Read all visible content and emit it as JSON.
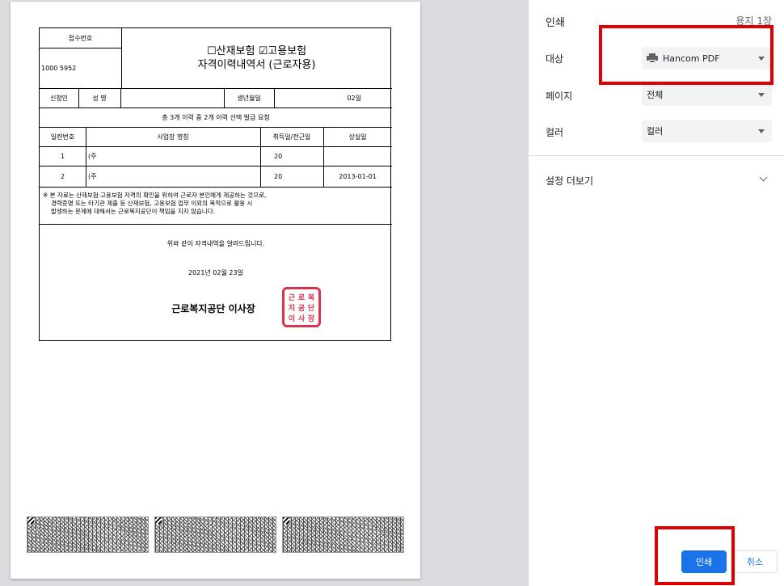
{
  "document": {
    "receipt_label": "접수번호",
    "receipt_number": "1000        5952",
    "title_line1": "☐산재보험 ☑고용보험",
    "title_line2": "자격이력내역서 (근로자용)",
    "applicant_label": "신청인",
    "name_label": "성 명",
    "name_value": "",
    "birth_label": "생년월일",
    "birth_value": "02일",
    "summary": "총  3개 이력 중 2개 이력 선택 발급 요청",
    "columns": [
      "일련번호",
      "사업장 명칭",
      "취득일/전근일",
      "상실일"
    ],
    "rows": [
      {
        "no": "1",
        "name": "(주",
        "acquired": "20",
        "lost": ""
      },
      {
        "no": "2",
        "name": "(주",
        "acquired": "20",
        "lost": "2013-01-01"
      }
    ],
    "notice_line1": "※ 본 자료는 산재보험·고용보험 자격의 확인을 위하여 근로자 본인에게 제공하는 것으로,",
    "notice_line2": "경력증명 또는 타기관 제출 등 산재보험, 고용보험 업무 이외의 목적으로 활용 시",
    "notice_line3": "발생하는 문제에 대해서는 근로복지공단이 책임을 지지 않습니다.",
    "confirm_text": "위와 같이 자격내역을 알려드립니다.",
    "date_text": "2021년 02월 23일",
    "issuer": "근로복지공단  이사장",
    "seal_chars": [
      "근",
      "로",
      "복",
      "지",
      "공",
      "단",
      "이",
      "사",
      "장"
    ]
  },
  "panel": {
    "title": "인쇄",
    "sheet_count": "용지 1장",
    "destination_label": "대상",
    "destination_value": "Hancom PDF",
    "pages_label": "페이지",
    "pages_value": "전체",
    "color_label": "컬러",
    "color_value": "컬러",
    "more_settings": "설정 더보기",
    "print_button": "인쇄",
    "cancel_button": "취소"
  },
  "colors": {
    "accent": "#1a73e8",
    "highlight": "#e00000",
    "seal": "#d9344e"
  }
}
